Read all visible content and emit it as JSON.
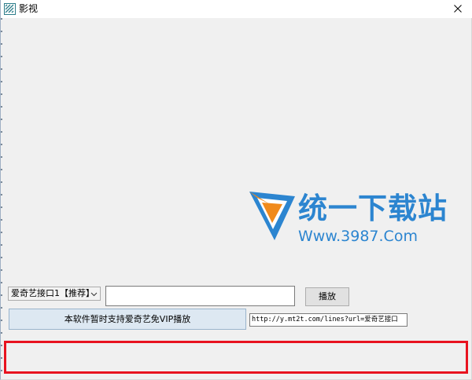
{
  "window": {
    "title": "影视",
    "close_glyph": "✕"
  },
  "logo": {
    "cn_text": "统一下载站",
    "url_text": "Www.3987.Com",
    "colors": {
      "blue": "#2c85d0",
      "orange": "#f08a1c"
    }
  },
  "controls": {
    "source_select": {
      "value": "爱奇艺接口1【推荐】"
    },
    "url_input": {
      "value": ""
    },
    "play_label": "播放",
    "notice_label": "本软件暂时支持爱奇艺免VIP播放",
    "api_url": "http://y.mt2t.com/lines?url=爱奇艺接口"
  },
  "colors": {
    "highlight_border": "#e8131f",
    "window_bg": "#f0f0f0"
  }
}
